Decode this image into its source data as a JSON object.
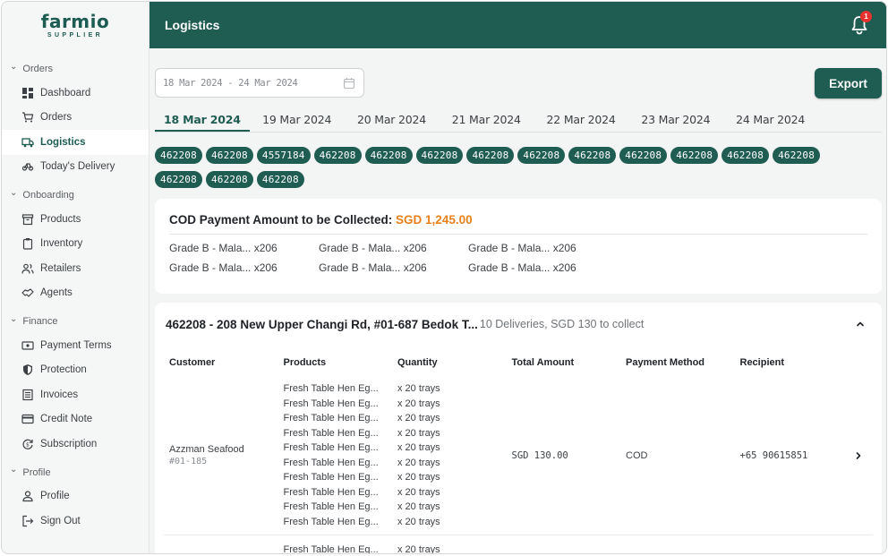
{
  "brand": {
    "name": "farmio",
    "sub": "SUPPLIER"
  },
  "header": {
    "title": "Logistics",
    "notification_count": "1"
  },
  "sidebar": {
    "sections": [
      {
        "title": "Orders",
        "items": [
          {
            "label": "Dashboard",
            "icon": "dashboard-icon"
          },
          {
            "label": "Orders",
            "icon": "cart-icon"
          },
          {
            "label": "Logistics",
            "icon": "truck-icon",
            "active": true
          },
          {
            "label": "Today's Delivery",
            "icon": "delivery-icon"
          }
        ]
      },
      {
        "title": "Onboarding",
        "items": [
          {
            "label": "Products",
            "icon": "archive-icon"
          },
          {
            "label": "Inventory",
            "icon": "clipboard-icon"
          },
          {
            "label": "Retailers",
            "icon": "users-icon"
          },
          {
            "label": "Agents",
            "icon": "handshake-icon"
          }
        ]
      },
      {
        "title": "Finance",
        "items": [
          {
            "label": "Payment Terms",
            "icon": "payment-icon"
          },
          {
            "label": "Protection",
            "icon": "shield-icon"
          },
          {
            "label": "Invoices",
            "icon": "invoice-icon"
          },
          {
            "label": "Credit Note",
            "icon": "credit-card-icon"
          },
          {
            "label": "Subscription",
            "icon": "subscription-icon"
          }
        ]
      },
      {
        "title": "Profile",
        "items": [
          {
            "label": "Profile",
            "icon": "user-icon"
          },
          {
            "label": "Sign Out",
            "icon": "sign-out-icon"
          }
        ]
      }
    ]
  },
  "date_range": {
    "value": "18 Mar 2024 - 24 Mar 2024"
  },
  "export_label": "Export",
  "tabs": [
    "18 Mar 2024",
    "19 Mar 2024",
    "20 Mar 2024",
    "21 Mar 2024",
    "22 Mar 2024",
    "23 Mar 2024",
    "24 Mar 2024"
  ],
  "chips": [
    "462208",
    "462208",
    "4557184",
    "462208",
    "462208",
    "462208",
    "462208",
    "462208",
    "462208",
    "462208",
    "462208",
    "462208",
    "462208",
    "462208",
    "462208",
    "462208"
  ],
  "cod": {
    "label": "COD Payment Amount to be Collected:",
    "amount": "SGD 1,245.00",
    "items": [
      "Grade B - Mala... x206",
      "Grade B - Mala... x206",
      "Grade B - Mala... x206",
      "Grade B - Mala... x206",
      "Grade B - Mala... x206",
      "Grade B - Mala... x206"
    ]
  },
  "delivery": {
    "title": "462208 - 208 New Upper Changi Rd, #01-687 Bedok T...",
    "summary": "10 Deliveries, SGD 130 to collect",
    "columns": [
      "Customer",
      "Products",
      "Quantity",
      "Total Amount",
      "Payment Method",
      "Recipient"
    ],
    "rows": [
      {
        "customer": "Azzman Seafood",
        "unit": "#01-185",
        "products": [
          "Fresh Table Hen Eg...",
          "Fresh Table Hen Eg...",
          "Fresh Table Hen Eg...",
          "Fresh Table Hen Eg...",
          "Fresh Table Hen Eg...",
          "Fresh Table Hen Eg...",
          "Fresh Table Hen Eg...",
          "Fresh Table Hen Eg...",
          "Fresh Table Hen Eg...",
          "Fresh Table Hen Eg..."
        ],
        "quantities": [
          "x 20 trays",
          "x 20 trays",
          "x 20 trays",
          "x 20 trays",
          "x 20 trays",
          "x 20 trays",
          "x 20 trays",
          "x 20 trays",
          "x 20 trays",
          "x 20 trays"
        ],
        "total": "SGD 130.00",
        "payment": "COD",
        "recipient": "+65 90615851"
      }
    ],
    "next_row": {
      "product": "Fresh Table Hen Eg...",
      "quantity": "x 20 trays"
    }
  }
}
